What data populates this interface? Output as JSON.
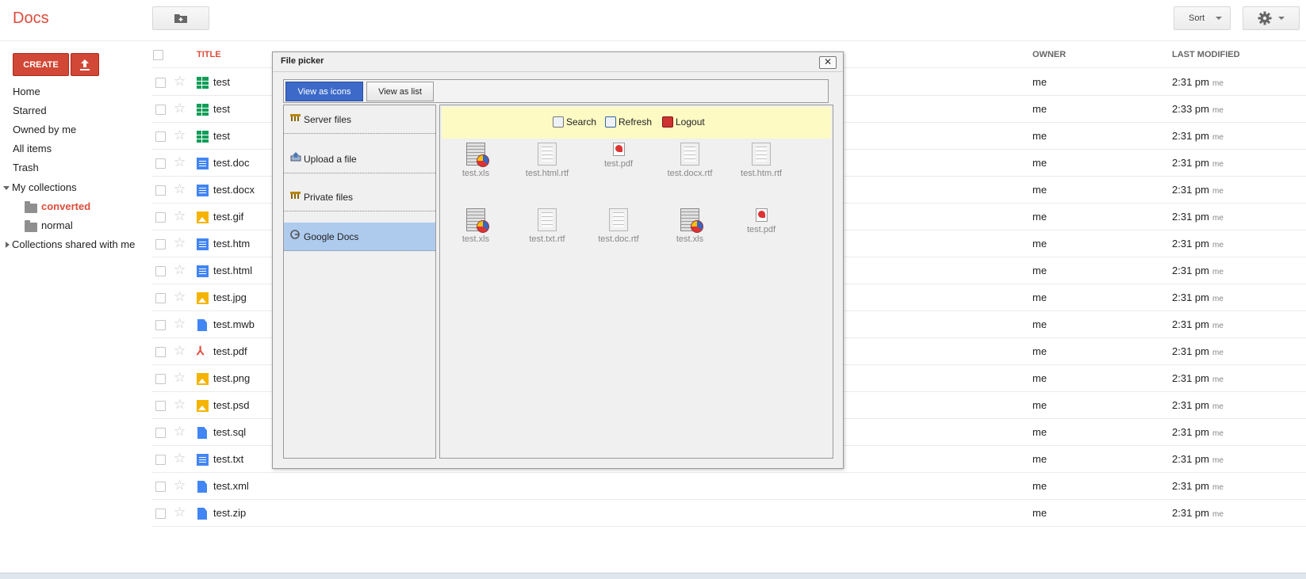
{
  "app": {
    "logo": "Docs"
  },
  "toolbar": {
    "sort_label": "Sort"
  },
  "sidebar": {
    "create_label": "CREATE",
    "items": [
      "Home",
      "Starred",
      "Owned by me",
      "All items",
      "Trash"
    ],
    "my_collections": "My collections",
    "collections": [
      "converted",
      "normal"
    ],
    "shared": "Collections shared with me"
  },
  "list": {
    "columns": {
      "title": "TITLE",
      "owner": "OWNER",
      "modified": "LAST MODIFIED"
    },
    "rows": [
      {
        "name": "test",
        "type": "sheet",
        "owner": "me",
        "time": "2:31 pm",
        "by": "me"
      },
      {
        "name": "test",
        "type": "sheet",
        "owner": "me",
        "time": "2:33 pm",
        "by": "me"
      },
      {
        "name": "test",
        "type": "sheet",
        "owner": "me",
        "time": "2:31 pm",
        "by": "me"
      },
      {
        "name": "test.doc",
        "type": "doc",
        "owner": "me",
        "time": "2:31 pm",
        "by": "me"
      },
      {
        "name": "test.docx",
        "type": "doc",
        "owner": "me",
        "time": "2:31 pm",
        "by": "me"
      },
      {
        "name": "test.gif",
        "type": "image",
        "owner": "me",
        "time": "2:31 pm",
        "by": "me"
      },
      {
        "name": "test.htm",
        "type": "doc",
        "owner": "me",
        "time": "2:31 pm",
        "by": "me"
      },
      {
        "name": "test.html",
        "type": "doc",
        "owner": "me",
        "time": "2:31 pm",
        "by": "me"
      },
      {
        "name": "test.jpg",
        "type": "image",
        "owner": "me",
        "time": "2:31 pm",
        "by": "me"
      },
      {
        "name": "test.mwb",
        "type": "file",
        "owner": "me",
        "time": "2:31 pm",
        "by": "me"
      },
      {
        "name": "test.pdf",
        "type": "pdf",
        "owner": "me",
        "time": "2:31 pm",
        "by": "me"
      },
      {
        "name": "test.png",
        "type": "image",
        "owner": "me",
        "time": "2:31 pm",
        "by": "me"
      },
      {
        "name": "test.psd",
        "type": "image",
        "owner": "me",
        "time": "2:31 pm",
        "by": "me"
      },
      {
        "name": "test.sql",
        "type": "file",
        "owner": "me",
        "time": "2:31 pm",
        "by": "me"
      },
      {
        "name": "test.txt",
        "type": "doc",
        "owner": "me",
        "time": "2:31 pm",
        "by": "me"
      },
      {
        "name": "test.xml",
        "type": "file",
        "owner": "me",
        "time": "2:31 pm",
        "by": "me"
      },
      {
        "name": "test.zip",
        "type": "file",
        "owner": "me",
        "time": "2:31 pm",
        "by": "me"
      }
    ]
  },
  "dialog": {
    "title": "File picker",
    "close": "✕",
    "tabs": [
      "View as icons",
      "View as list"
    ],
    "sources": [
      "Server files",
      "Upload a file",
      "Private files",
      "Google Docs"
    ],
    "tools": [
      "Search",
      "Refresh",
      "Logout"
    ],
    "files": [
      {
        "name": "test.xls",
        "icon": "spreadsheet-file-icon"
      },
      {
        "name": "test.html.rtf",
        "icon": "document-file-icon"
      },
      {
        "name": "test.pdf",
        "icon": "pdf-file-icon"
      },
      {
        "name": "test.docx.rtf",
        "icon": "document-file-icon"
      },
      {
        "name": "test.htm.rtf",
        "icon": "document-file-icon"
      },
      {
        "name": "test.xls",
        "icon": "spreadsheet-file-icon"
      },
      {
        "name": "test.txt.rtf",
        "icon": "document-file-icon"
      },
      {
        "name": "test.doc.rtf",
        "icon": "document-file-icon"
      },
      {
        "name": "test.xls",
        "icon": "spreadsheet-file-icon"
      },
      {
        "name": "test.pdf",
        "icon": "pdf-file-icon"
      }
    ]
  },
  "colors": {
    "brand_red": "#dd4b39",
    "create_button": "#d14836",
    "tab_active": "#3d6ac9",
    "selected_source": "#aecbee",
    "toolstrip": "#fdfac4"
  }
}
